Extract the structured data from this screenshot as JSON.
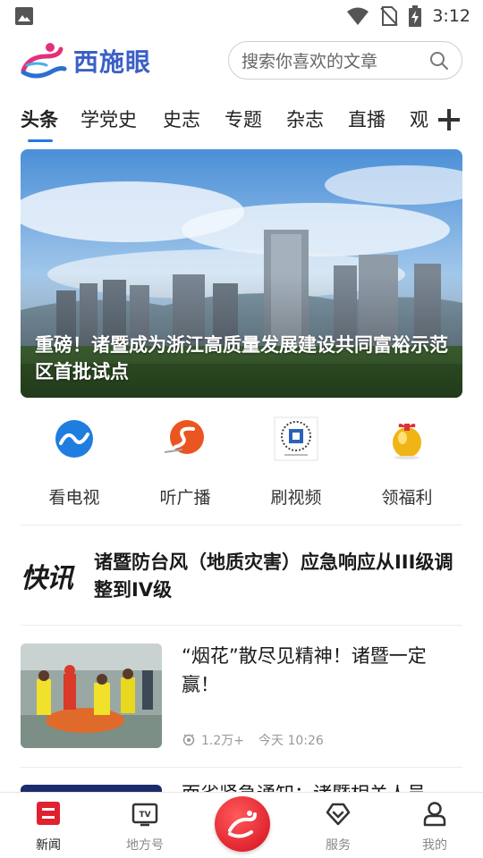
{
  "status_bar": {
    "time": "3:12"
  },
  "header": {
    "logo_text": "西施眼",
    "search_placeholder": "搜索你喜欢的文章"
  },
  "tabs": [
    {
      "label": "头条",
      "active": true
    },
    {
      "label": "学党史"
    },
    {
      "label": "史志"
    },
    {
      "label": "专题"
    },
    {
      "label": "杂志"
    },
    {
      "label": "直播"
    },
    {
      "label": "观"
    }
  ],
  "banner": {
    "caption": "重磅！诸暨成为浙江高质量发展建设共同富裕示范区首批试点"
  },
  "quick_entries": [
    {
      "label": "看电视",
      "icon": "tv-logo-icon"
    },
    {
      "label": "听广播",
      "icon": "radio-logo-icon"
    },
    {
      "label": "刷视频",
      "icon": "qr-code-icon"
    },
    {
      "label": "领福利",
      "icon": "golden-egg-icon"
    }
  ],
  "flash_news": {
    "tag": "快讯",
    "text": "诸暨防台风（地质灾害）应急响应从III级调整到IV级"
  },
  "articles": [
    {
      "title": "“烟花”散尽见精神！诸暨一定赢！",
      "views": "1.2万+",
      "time": "今天 10:26"
    },
    {
      "title": "面省紧急通知：诸暨相关人员"
    }
  ],
  "bottom_nav": [
    {
      "label": "新闻",
      "active": true,
      "icon": "news-icon"
    },
    {
      "label": "地方号",
      "icon": "tv-icon"
    },
    {
      "label": "",
      "icon": "center-logo-icon"
    },
    {
      "label": "服务",
      "icon": "service-icon"
    },
    {
      "label": "我的",
      "icon": "user-icon"
    }
  ],
  "colors": {
    "accent_blue": "#1f7de0",
    "brand_red": "#e0212f",
    "logo_blue": "#3b5fc7"
  }
}
